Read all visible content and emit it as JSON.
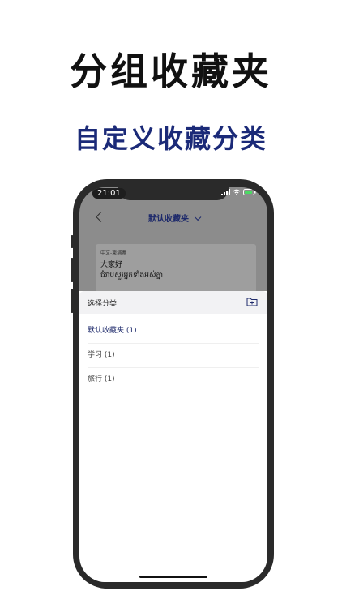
{
  "banner": {
    "title": "分组收藏夹",
    "subtitle": "自定义收藏分类"
  },
  "colors": {
    "title_text": "#111111",
    "subtitle_text": "#1b2a78",
    "accent": "#1e2a6b",
    "sheet_header_bg": "#f2f2f4",
    "phone_frame": "#2a2a2a"
  },
  "status_bar": {
    "time": "21:01",
    "icons": [
      "signal-icon",
      "wifi-icon",
      "battery-icon"
    ]
  },
  "app_header": {
    "back_icon": "chevron-left-icon",
    "title": "默认收藏夹",
    "dropdown_icon": "chevron-down-icon"
  },
  "phrase_card": {
    "language_pair": "中文-柬埔寨",
    "source_text": "大家好",
    "translation": "ជំរាបសួរអ្នកទាំងអស់គ្នា"
  },
  "category_sheet": {
    "title": "选择分类",
    "add_folder_icon": "folder-plus-icon",
    "options": [
      {
        "label": "默认收藏夹 (1)",
        "selected": true
      },
      {
        "label": "学习 (1)",
        "selected": false
      },
      {
        "label": "旅行 (1)",
        "selected": false
      }
    ]
  }
}
